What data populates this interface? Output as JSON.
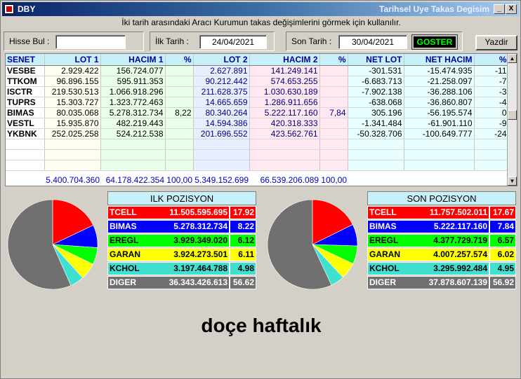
{
  "window": {
    "app_title": "DBY",
    "right_title": "Tarihsel Uye Takas Degisim",
    "min": "_",
    "max": "□",
    "close": "X"
  },
  "info_text": "İki tarih arasındaki  Aracı Kurumun takas değişimlerini görmek için kullanılır.",
  "controls": {
    "hisse_label": "Hisse Bul :",
    "hisse_value": "",
    "ilk_label": "İlk Tarih :",
    "ilk_value": "24/04/2021",
    "son_label": "Son Tarih :",
    "son_value": "30/04/2021",
    "goster": "GOSTER",
    "yazdir": "Yazdir"
  },
  "table": {
    "headers": [
      "SENET",
      "LOT 1",
      "HACIM 1",
      "%",
      "LOT 2",
      "HACIM 2",
      "%",
      "NET LOT",
      "NET HACIM",
      "%"
    ],
    "rows": [
      [
        "VESBE",
        "2.929.422",
        "156.724.077",
        "",
        "2.627.891",
        "141.249.141",
        "",
        "-301.531",
        "-15.474.935",
        "-11"
      ],
      [
        "TTKOM",
        "96.896.155",
        "595.911.353",
        "",
        "90.212.442",
        "574.653.255",
        "",
        "-6.683.713",
        "-21.258.097",
        "-7"
      ],
      [
        "ISCTR",
        "219.530.513",
        "1.066.918.296",
        "",
        "211.628.375",
        "1.030.630.189",
        "",
        "-7.902.138",
        "-36.288.106",
        "-3"
      ],
      [
        "TUPRS",
        "15.303.727",
        "1.323.772.463",
        "",
        "14.665.659",
        "1.286.911.656",
        "",
        "-638.068",
        "-36.860.807",
        "-4"
      ],
      [
        "BIMAS",
        "80.035.068",
        "5.278.312.734",
        "8,22",
        "80.340.264",
        "5.222.117.160",
        "7,84",
        "305.196",
        "-56.195.574",
        "0"
      ],
      [
        "VESTL",
        "15.935.870",
        "482.219.443",
        "",
        "14.594.386",
        "420.318.333",
        "",
        "-1.341.484",
        "-61.901.110",
        "-9"
      ],
      [
        "YKBNK",
        "252.025.258",
        "524.212.538",
        "",
        "201.696.552",
        "423.562.761",
        "",
        "-50.328.706",
        "-100.649.777",
        "-24"
      ],
      [
        "",
        "",
        "",
        "",
        "",
        "",
        "",
        "",
        "",
        ""
      ],
      [
        "",
        "",
        "",
        "",
        "",
        "",
        "",
        "",
        "",
        ""
      ],
      [
        "",
        "",
        "",
        "",
        "",
        "",
        "",
        "",
        "",
        ""
      ]
    ],
    "totals": [
      "5.400.704.360",
      "64.178.422.354",
      "100,00",
      "5.349.152.699",
      "66.539.206.089",
      "100,00"
    ]
  },
  "ilk": {
    "title": "ILK POZISYON",
    "rows": [
      {
        "name": "TCELL",
        "value": "11.505.595.695",
        "pct": "17.92",
        "color": "#ff0000"
      },
      {
        "name": "BIMAS",
        "value": "5.278.312.734",
        "pct": "8.22",
        "color": "#0000ff"
      },
      {
        "name": "EREGL",
        "value": "3.929.349.020",
        "pct": "6.12",
        "color": "#00ff00"
      },
      {
        "name": "GARAN",
        "value": "3.924.273.501",
        "pct": "6.11",
        "color": "#ffff00"
      },
      {
        "name": "KCHOL",
        "value": "3.197.464.788",
        "pct": "4.98",
        "color": "#40e0d0"
      },
      {
        "name": "DIGER",
        "value": "36.343.426.613",
        "pct": "56.62",
        "color": "#707070"
      }
    ]
  },
  "son": {
    "title": "SON POZISYON",
    "rows": [
      {
        "name": "TCELL",
        "value": "11.757.502.011",
        "pct": "17.67",
        "color": "#ff0000"
      },
      {
        "name": "BIMAS",
        "value": "5.222.117.160",
        "pct": "7.84",
        "color": "#0000ff"
      },
      {
        "name": "EREGL",
        "value": "4.377.729.719",
        "pct": "6.57",
        "color": "#00ff00"
      },
      {
        "name": "GARAN",
        "value": "4.007.257.574",
        "pct": "6.02",
        "color": "#ffff00"
      },
      {
        "name": "KCHOL",
        "value": "3.295.992.484",
        "pct": "4.95",
        "color": "#40e0d0"
      },
      {
        "name": "DIGER",
        "value": "37.878.607.139",
        "pct": "56.92",
        "color": "#707070"
      }
    ]
  },
  "footer_text": "doçe haftalık"
}
